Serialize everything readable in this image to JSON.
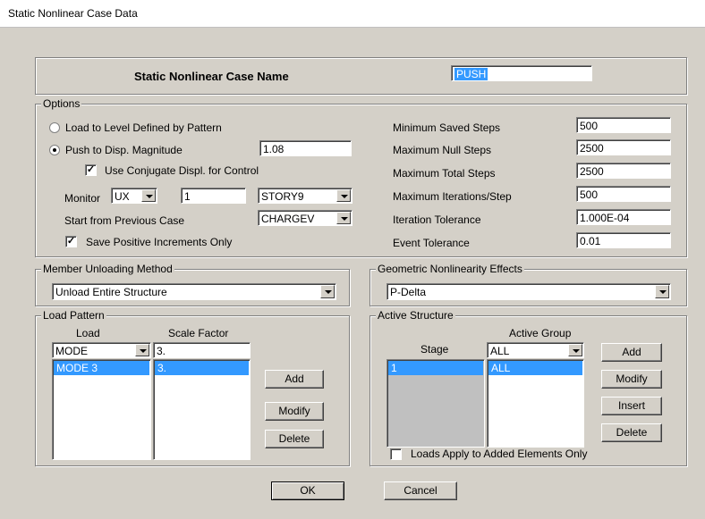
{
  "window": {
    "title": "Static Nonlinear Case Data"
  },
  "case_name": {
    "label": "Static Nonlinear Case  Name",
    "value": "PUSH"
  },
  "options": {
    "legend": "Options",
    "load_to_level_label": "Load to Level Defined by Pattern",
    "push_to_disp_label": "Push to Disp. Magnitude",
    "push_to_disp_value": "1.08",
    "use_conjugate_label": "Use Conjugate Displ. for Control",
    "monitor_label": "Monitor",
    "monitor_dir": "UX",
    "monitor_joint": "1",
    "monitor_story": "STORY9",
    "start_from_label": "Start from Previous Case",
    "start_from_value": "CHARGEV",
    "save_positive_label": "Save Positive Increments Only",
    "min_saved_label": "Minimum Saved Steps",
    "min_saved_value": "500",
    "max_null_label": "Maximum Null Steps",
    "max_null_value": "2500",
    "max_total_label": "Maximum Total Steps",
    "max_total_value": "2500",
    "max_iter_label": "Maximum Iterations/Step",
    "max_iter_value": "500",
    "iter_tol_label": "Iteration Tolerance",
    "iter_tol_value": "1.000E-04",
    "event_tol_label": "Event Tolerance",
    "event_tol_value": "0.01"
  },
  "member_unloading": {
    "legend": "Member Unloading Method",
    "value": "Unload Entire Structure"
  },
  "geometric_nonlinearity": {
    "legend": "Geometric Nonlinearity Effects",
    "value": "P-Delta"
  },
  "load_pattern": {
    "legend": "Load Pattern",
    "load_header": "Load",
    "scale_header": "Scale Factor",
    "load_input": "MODE",
    "scale_input": "3.",
    "rows": [
      {
        "load": "MODE 3",
        "scale": "3."
      }
    ],
    "add_label": "Add",
    "modify_label": "Modify",
    "delete_label": "Delete"
  },
  "active_structure": {
    "legend": "Active Structure",
    "group_header": "Active Group",
    "stage_header": "Stage",
    "group_input": "ALL",
    "rows": [
      {
        "stage": "1",
        "group": "ALL"
      }
    ],
    "add_label": "Add",
    "modify_label": "Modify",
    "insert_label": "Insert",
    "delete_label": "Delete",
    "loads_apply_label": "Loads Apply to Added Elements Only"
  },
  "footer": {
    "ok_label": "OK",
    "cancel_label": "Cancel"
  }
}
